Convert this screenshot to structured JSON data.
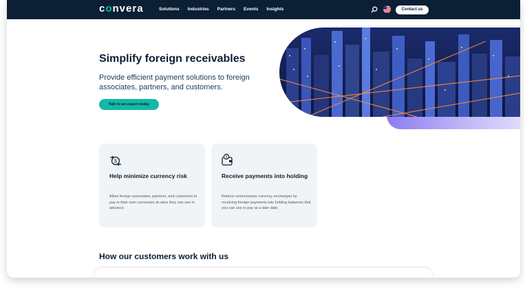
{
  "brand": {
    "name_start": "c",
    "name_accent": "o",
    "name_end": "nvera"
  },
  "nav": {
    "links": [
      "Solutions",
      "Industries",
      "Partners",
      "Events",
      "Insights"
    ],
    "contact_label": "Contact us",
    "icons": {
      "search": "search-icon",
      "flag": "us-flag-icon"
    }
  },
  "hero": {
    "title": "Simplify foreign receivables",
    "subtitle": "Provide efficient payment solutions to foreign associates, partners, and customers.",
    "cta_label": "Talk to an expert today"
  },
  "cards": [
    {
      "icon": "currency-exchange-icon",
      "title": "Help minimize currency risk",
      "body": "Allow foreign associates, partners, and customers to pay in their own currencies at rates they can see in advance."
    },
    {
      "icon": "wallet-currency-icon",
      "title": "Receive payments into holding",
      "body": "Reduce unnecessary currency exchanges by receiving foreign payments into holding balances that you can use to pay at a later date."
    }
  ],
  "section": {
    "title": "How our customers work with us"
  },
  "colors": {
    "navy": "#0b1f35",
    "teal": "#14b8a6",
    "card_bg": "#f1f4f6",
    "lavender": "#8b7cf0"
  }
}
